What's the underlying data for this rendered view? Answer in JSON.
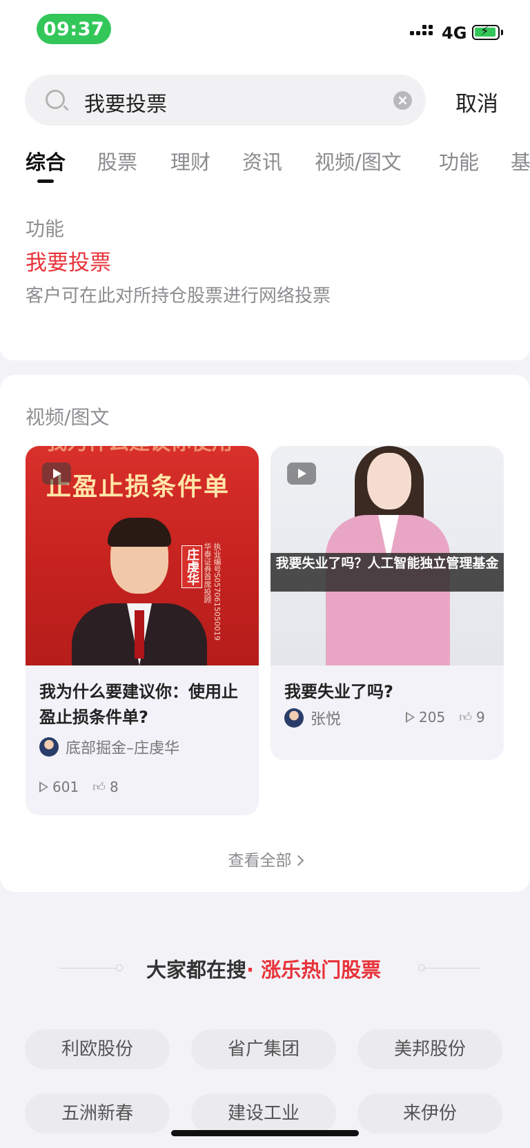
{
  "status_bar": {
    "time": "09:37",
    "network": "4G"
  },
  "search": {
    "query": "我要投票",
    "cancel_label": "取消"
  },
  "tabs": [
    "综合",
    "股票",
    "理财",
    "资讯",
    "视频/图文",
    "功能",
    "基"
  ],
  "function_section": {
    "heading": "功能",
    "title": "我要投票",
    "description": "客户可在此对所持仓股票进行网络投票"
  },
  "video_section": {
    "heading": "视频/图文",
    "items": [
      {
        "overlay_text": "止盈止损条件单",
        "overlay_top": "我为什么建议你使用",
        "name_tag": "庄虔华",
        "side_text": "执业编号S0570615050019 华泰证券首席投顾",
        "title": "我为什么要建议你：使用止盈止损条件单?",
        "author": "底部掘金–庄虔华",
        "plays": "601",
        "likes": "8"
      },
      {
        "overlay_text": "我要失业了吗？人工智能独立管理基金",
        "title": "我要失业了吗?",
        "author": "张悦",
        "plays": "205",
        "likes": "9"
      }
    ],
    "view_all_label": "查看全部"
  },
  "hot_stocks": {
    "title_prefix": "大家都在搜",
    "title_accent": "· 涨乐热门股票",
    "chips": [
      "利欧股份",
      "省广集团",
      "美邦股份",
      "五洲新春",
      "建设工业",
      "来伊份"
    ]
  }
}
